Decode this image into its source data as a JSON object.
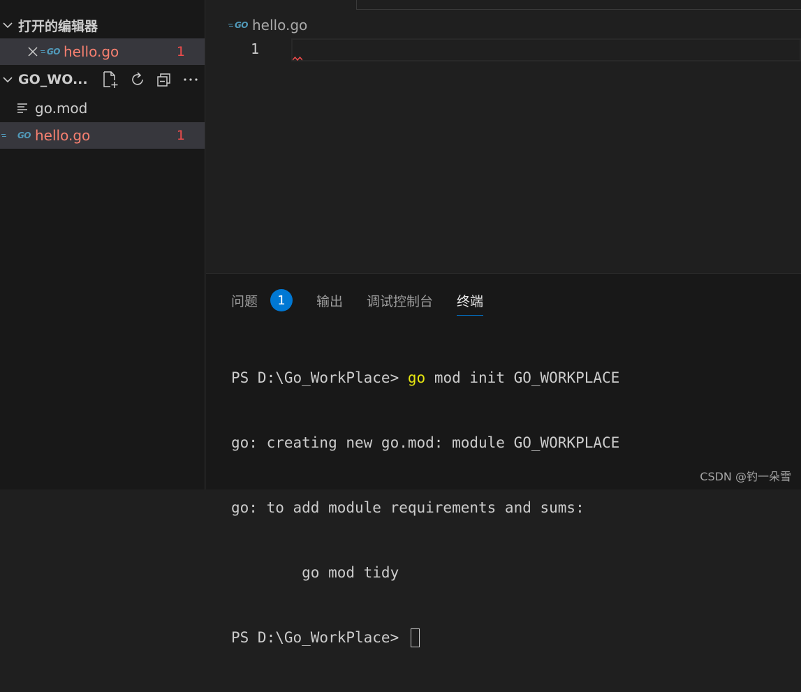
{
  "sidebar": {
    "open_editors_title": "打开的编辑器",
    "open_editors": [
      {
        "name": "hello.go",
        "problems": "1"
      }
    ],
    "workspace_title": "GO_WO...",
    "files": [
      {
        "name": "go.mod",
        "problems": ""
      },
      {
        "name": "hello.go",
        "problems": "1"
      }
    ]
  },
  "editor": {
    "breadcrumb_file": "hello.go",
    "line_number": "1",
    "go_icon_text": "GO"
  },
  "panel": {
    "tabs": [
      {
        "label": "问题",
        "badge": "1"
      },
      {
        "label": "输出"
      },
      {
        "label": "调试控制台"
      },
      {
        "label": "终端"
      }
    ],
    "active_tab": "终端",
    "terminal": {
      "line1_prompt": "PS D:\\Go_WorkPlace> ",
      "line1_cmd": "go",
      "line1_rest": " mod init GO_WORKPLACE",
      "line2": "go: creating new go.mod: module GO_WORKPLACE",
      "line3": "go: to add module requirements and sums:",
      "line4": "        go mod tidy",
      "line5_prompt": "PS D:\\Go_WorkPlace> "
    }
  },
  "watermark": "CSDN @钓一朵雪",
  "colors": {
    "accent": "#0078d4",
    "error": "#f88070",
    "go_icon": "#519aba",
    "command": "#e5e510"
  }
}
